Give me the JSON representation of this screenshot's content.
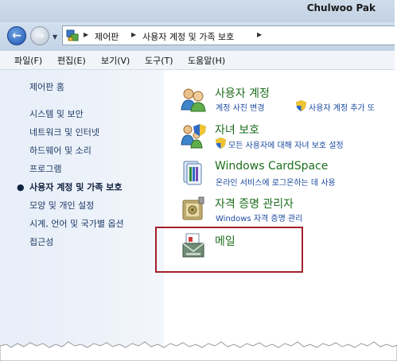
{
  "title_bar": {
    "user_name": "Chulwoo Pak"
  },
  "address_bar": {
    "crumbs": [
      "제어판",
      "사용자 계정 및 가족 보호"
    ]
  },
  "menu": [
    "파일(F)",
    "편집(E)",
    "보기(V)",
    "도구(T)",
    "도움말(H)"
  ],
  "sidebar": {
    "items": [
      "제어판 홈",
      "시스템 및 보안",
      "네트워크 및 인터넷",
      "하드웨어 및 소리",
      "프로그램",
      "사용자 계정 및 가족 보호",
      "모양 및 개인 설정",
      "시계, 언어 및 국가별 옵션",
      "접근성"
    ],
    "active_index": 5
  },
  "categories": [
    {
      "title": "사용자 계정",
      "icon": "user-accounts-icon",
      "links": [
        "계정 사진 변경",
        "사용자 계정 추가 또"
      ]
    },
    {
      "title": "자녀 보호",
      "icon": "parental-controls-icon",
      "links": [
        "모든 사용자에 대해 자녀 보호 설정"
      ]
    },
    {
      "title": "Windows CardSpace",
      "icon": "cardspace-icon",
      "links": [
        "온라인 서비스에 로그온하는 데 사용"
      ]
    },
    {
      "title": "자격 증명 관리자",
      "icon": "credential-manager-icon",
      "links": [
        "Windows 자격 증명 관리"
      ]
    },
    {
      "title": "메일",
      "icon": "mail-icon",
      "links": []
    }
  ],
  "colors": {
    "category_title": "#1e6f1e",
    "link": "#1c4aa0",
    "sidebar_text": "#1f3b68",
    "callout_border": "#a3202b"
  }
}
